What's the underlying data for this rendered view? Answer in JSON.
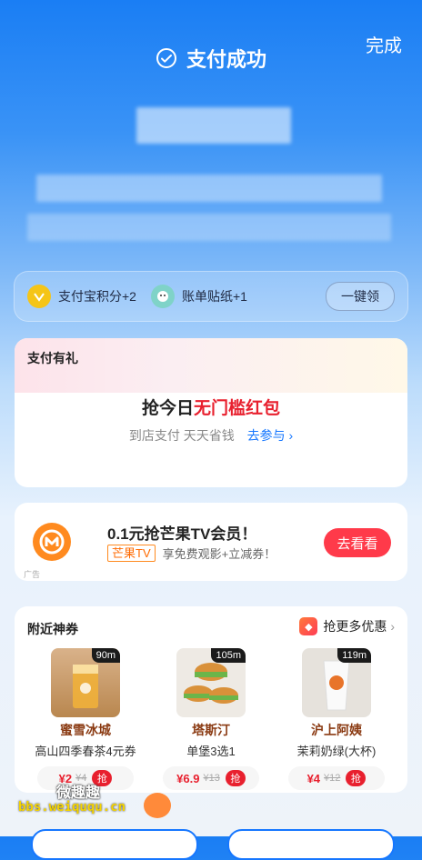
{
  "header": {
    "done_label": "完成",
    "status_text": "支付成功"
  },
  "points": {
    "item1_label": "支付宝积分+2",
    "item2_label": "账单贴纸+1",
    "action_label": "一键领"
  },
  "gift_card": {
    "title": "支付有礼",
    "main_prefix": "抢今日",
    "main_highlight": "无门槛红包",
    "sub_text": "到店支付 天天省钱",
    "link_text": "去参与"
  },
  "ad": {
    "title": "0.1元抢芒果TV会员！",
    "brand": "芒果TV",
    "desc": "享免费观影+立减券！",
    "button": "去看看",
    "tag": "广告"
  },
  "nearby": {
    "title": "附近神券",
    "more_label": "抢更多优惠",
    "shops": [
      {
        "distance": "90m",
        "name": "蜜雪冰城",
        "desc": "高山四季春茶4元券",
        "price": "¥2",
        "orig": "¥4",
        "grab": "抢"
      },
      {
        "distance": "105m",
        "name": "塔斯汀",
        "desc": "单堡3选1",
        "price": "¥6.9",
        "orig": "¥13",
        "grab": "抢"
      },
      {
        "distance": "119m",
        "name": "沪上阿姨",
        "desc": "茉莉奶绿(大杯)",
        "price": "¥4",
        "orig": "¥12",
        "grab": "抢"
      }
    ]
  },
  "watermark": {
    "line1": "微趣趣",
    "line2": "bbs.weiququ.cn"
  },
  "colors": {
    "primary_blue": "#1677ff",
    "accent_red": "#e8202e",
    "mango_orange": "#ff8a1f"
  }
}
